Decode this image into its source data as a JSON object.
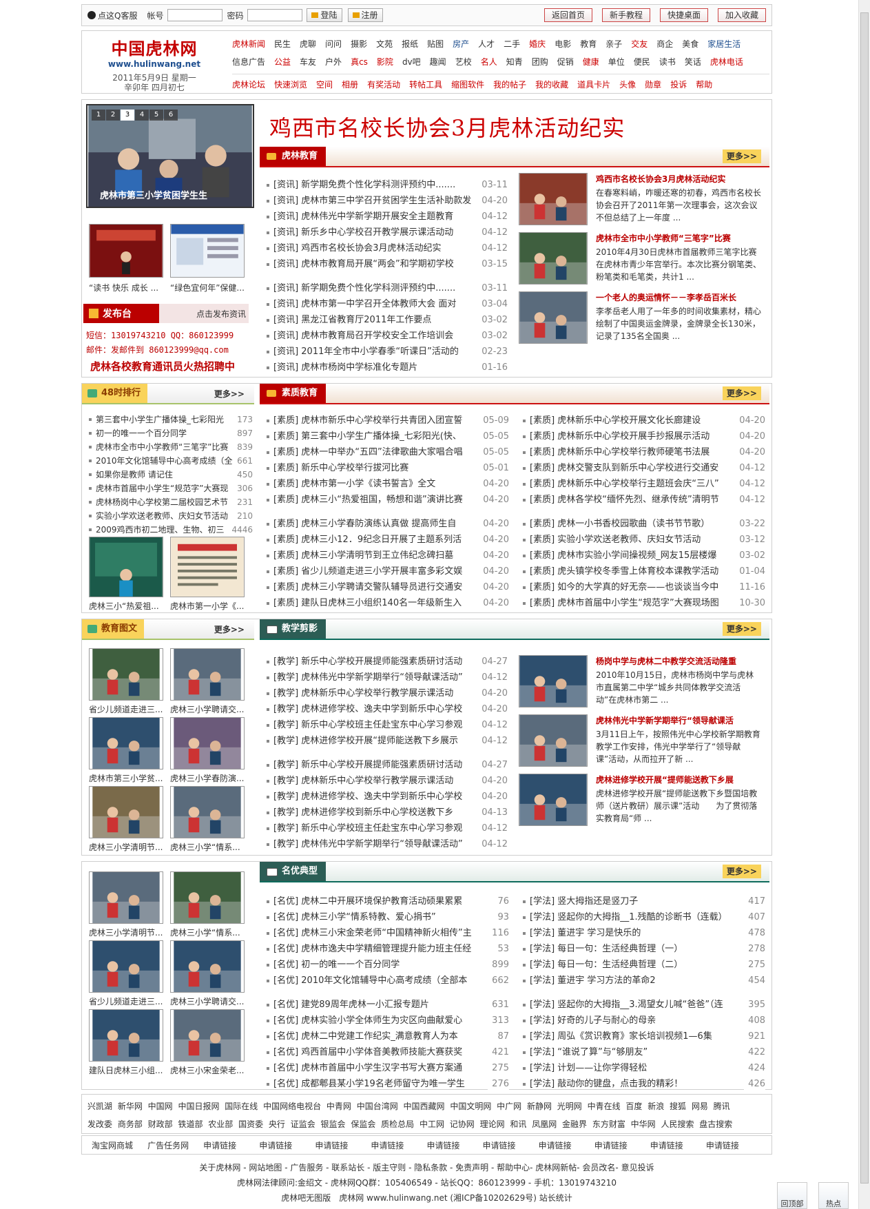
{
  "topbar": {
    "qq": "点这Q客服",
    "user_label": "帐号",
    "pass_label": "密码",
    "login": "登陆",
    "register": "注册",
    "home": "返回首页",
    "tutorial": "新手教程",
    "desktop": "快捷桌面",
    "favorite": "加入收藏"
  },
  "header": {
    "logo": "中国虎林网",
    "url": "www.hulinwang.net",
    "date": "2011年5月9日 星期一",
    "lunar": "辛卯年 四月初七",
    "nav1": [
      "虎林新闻",
      "民生",
      "虎聊",
      "问问",
      "摄影",
      "文苑",
      "报纸",
      "贴图",
      "房产",
      "人才",
      "二手",
      "婚庆",
      "电影",
      "教育",
      "亲子",
      "交友",
      "商企",
      "美食",
      "家居生活"
    ],
    "nav2": [
      "信息广告",
      "公益",
      "车友",
      "户外",
      "真cs",
      "影院",
      "dv吧",
      "趣闻",
      "艺校",
      "名人",
      "知青",
      "团购",
      "促销",
      "健康",
      "单位",
      "便民",
      "读书",
      "笑话",
      "虎林电话"
    ],
    "nav3": [
      "虎林论坛",
      "快速浏览",
      "空间",
      "相册",
      "有奖活动",
      "转帖工具",
      "缩图软件",
      "我的帖子",
      "我的收藏",
      "道具卡片",
      "头像",
      "勋章",
      "投诉",
      "帮助"
    ]
  },
  "colors": {
    "brand": "#c00000",
    "accent_teal": "#2c5d55",
    "gold": "#f9d35b"
  },
  "slider": {
    "tabs": [
      "1",
      "2",
      "3",
      "4",
      "5",
      "6"
    ],
    "caption": "虎林市第三小学贫困学生生"
  },
  "headline": "鸡西市名校长协会3月虎林活动纪实",
  "edu": {
    "title": "虎林教育",
    "more": "更多>>",
    "items": [
      [
        "[资讯] 新学期免费个性化学科测评预约中.......",
        "03-11"
      ],
      [
        "[资讯] 虎林市第三中学召开贫困学生生活补助款发",
        "04-20"
      ],
      [
        "[资讯] 虎林伟光中学新学期开展安全主题教育",
        "04-12"
      ],
      [
        "[资讯] 新乐乡中心学校召开教学展示课活动动",
        "04-12"
      ],
      [
        "[资讯] 鸡西市名校长协会3月虎林活动纪实",
        "04-12"
      ],
      [
        "[资讯] 虎林市教育局开展“两会”和学期初学校",
        "03-15"
      ]
    ],
    "items2": [
      [
        "[资讯] 新学期免费个性化学科测评预约中.......",
        "03-11"
      ],
      [
        "[资讯] 虎林市第一中学召开全体教师大会 面对",
        "03-04"
      ],
      [
        "[资讯] 黑龙江省教育厅2011年工作要点",
        "03-02"
      ],
      [
        "[资讯] 虎林市教育局召开学校安全工作培训会",
        "03-02"
      ],
      [
        "[资讯] 2011年全市中小学春季“听课日”活动的",
        "02-23"
      ],
      [
        "[资讯] 虎林市杨岗中学标准化专题片",
        "01-16"
      ]
    ],
    "news": [
      {
        "title": "鸡西市名校长协会3月虎林活动纪实",
        "text": "在春寒料峭，咋暖还寒的初春，鸡西市名校长协会召开了2011年第一次理事会，这次会议不但总结了上一年度 ..."
      },
      {
        "title": "虎林市全市中小学教师“三笔字”比赛",
        "text": "2010年4月30日虎林市首届教师三笔字比赛在虎林市青少年宫举行。本次比赛分钢笔类、粉笔类和毛笔类，共计1 ..."
      },
      {
        "title": "一个老人的奥运情怀－－李孝岳百米长",
        "text": "李孝岳老人用了一年多的时间收集素材，精心绘制了中国奥运金牌录，金牌录全长130米，记录了135名全国奥 ..."
      }
    ]
  },
  "small_pics": [
    "“读书 快乐 成长 ...",
    "“绿色宜何年”保健..."
  ],
  "publish": {
    "title": "发布台",
    "action": "点击发布资讯",
    "sms": "短信：13019743210  QQ：860123999",
    "email": "邮件：发邮件到 860123999@qq.com",
    "recruit": "虎林各校教育通讯员火热招聘中"
  },
  "rank": {
    "title": "48时排行",
    "more": "更多>>",
    "items": [
      [
        "第三套中小学生广播体操_七彩阳光",
        "173"
      ],
      [
        "初一的唯一一个百分同学",
        "897"
      ],
      [
        "虎林市全市中小学教师“三笔字”比赛",
        "839"
      ],
      [
        "2010年文化馆辅导中心高考成绩（全",
        "661"
      ],
      [
        "如果你是教师 请记住",
        "450"
      ],
      [
        "虎林市首届中小学生“规范字”大赛现",
        "306"
      ],
      [
        "虎林杨岗中心学校第二届校园艺术节",
        "231"
      ],
      [
        "实验小学欢送老教师、庆妇女节活动",
        "210"
      ],
      [
        "2009鸡西市初二地理、生物、初三",
        "4446"
      ]
    ],
    "pics": [
      "虎林三小“热爱祖...",
      "虎林市第一小学《..."
    ]
  },
  "quality": {
    "title": "素质教育",
    "more": "更多>>",
    "left": [
      [
        "[素质] 虎林市新乐中心学校举行共青团入团宣誓",
        "05-09"
      ],
      [
        "[素质] 第三套中小学生广播体操_七彩阳光(快、",
        "05-05"
      ],
      [
        "[素质] 虎林一中举办“五四”法律歌曲大家唱合唱",
        "05-05"
      ],
      [
        "[素质] 新乐中心学校举行拔河比赛",
        "05-01"
      ],
      [
        "[素质] 虎林市第一小学《读书誓言》全文",
        "04-20"
      ],
      [
        "[素质] 虎林三小“热爱祖国，畅想和谐”演讲比赛",
        "04-20"
      ]
    ],
    "left2": [
      [
        "[素质] 虎林三小学春防演练认真做 提高师生自",
        "04-20"
      ],
      [
        "[素质] 虎林三小12．9纪念日开展了主题系列活",
        "04-20"
      ],
      [
        "[素质] 虎林三小学清明节到王立伟纪念碑扫墓",
        "04-20"
      ],
      [
        "[素质] 省少儿频道走进三小学开展丰富多彩文娱",
        "04-20"
      ],
      [
        "[素质] 虎林三小学聘请交警队辅导员进行交通安",
        "04-20"
      ],
      [
        "[素质] 建队日虎林三小组织140名一年级新生入",
        "04-20"
      ]
    ],
    "right": [
      [
        "[素质] 虎林新乐中心学校开展文化长廊建设",
        "04-20"
      ],
      [
        "[素质] 虎林新乐中心学校开展手抄报展示活动",
        "04-20"
      ],
      [
        "[素质] 虎林新乐中心学校举行教师硬笔书法展",
        "04-20"
      ],
      [
        "[素质] 虎林交警支队到新乐中心学校进行交通安",
        "04-12"
      ],
      [
        "[素质] 虎林新乐中心学校举行主题班会庆“三八”",
        "04-12"
      ],
      [
        "[素质] 虎林各学校“缅怀先烈、继承传统”清明节",
        "04-12"
      ]
    ],
    "right2": [
      [
        "[素质] 虎林一小书香校园歌曲（读书节节歌）",
        "03-22"
      ],
      [
        "[素质] 实验小学欢送老教师、庆妇女节活动",
        "03-12"
      ],
      [
        "[素质] 虎林市实验小学间操视频_网友15层楼爆",
        "03-02"
      ],
      [
        "[素质] 虎头镇学校冬季雪上体育校本课教学活动",
        "01-04"
      ],
      [
        "[素质] 如今的大学真的好无奈——也谈谈当今中",
        "11-16"
      ],
      [
        "[素质] 虎林市首届中小学生“规范字”大赛现场图",
        "10-30"
      ]
    ]
  },
  "pictext": {
    "title": "教育图文",
    "more": "更多>>",
    "caps": [
      "省少儿频道走进三...",
      "虎林三小学聘请交...",
      "虎林市第三小学贫...",
      "虎林三小学春防演...",
      "虎林三小学清明节...",
      "虎林三小学“情系..."
    ]
  },
  "teaching": {
    "title": "教学剪影",
    "more": "更多>>",
    "items": [
      [
        "[教学] 新乐中心学校开展提师能强素质研讨活动",
        "04-27"
      ],
      [
        "[教学] 虎林伟光中学新学期举行“领导献课活动”",
        "04-12"
      ],
      [
        "[教学] 虎林新乐中心学校举行教学展示课活动",
        "04-20"
      ],
      [
        "[教学] 虎林进修学校、逸夫中学到新乐中心学校",
        "04-20"
      ],
      [
        "[教学] 新乐中心学校班主任赴宝东中心学习参观",
        "04-12"
      ],
      [
        "[教学] 虎林进修学校开展“提师能送教下乡展示",
        "04-12"
      ]
    ],
    "items2": [
      [
        "[教学] 新乐中心学校开展提师能强素质研讨活动",
        "04-27"
      ],
      [
        "[教学] 虎林新乐中心学校举行教学展示课活动",
        "04-20"
      ],
      [
        "[教学] 虎林进修学校、逸夫中学到新乐中心学校",
        "04-20"
      ],
      [
        "[教学] 虎林进修学校到新乐中心学校送教下乡",
        "04-13"
      ],
      [
        "[教学] 新乐中心学校班主任赴宝东中心学习参观",
        "04-12"
      ],
      [
        "[教学] 虎林伟光中学新学期举行“领导献课活动”",
        "04-12"
      ]
    ],
    "news": [
      {
        "title": "杨岗中学与虎林二中教学交流活动隆重",
        "text": "2010年10月15日，虎林市杨岗中学与虎林市直属第二中学“城乡共同体教学交流活动”在虎林市第二 ..."
      },
      {
        "title": "虎林伟光中学新学期举行“领导献课活",
        "text": "3月11日上午，按照伟光中心学校新学期教育教学工作安排，伟光中学举行了“领导献课”活动，从而拉开了新 ..."
      },
      {
        "title": "虎林进修学校开展“提师能送教下乡展",
        "text": "虎林进修学校开展“提师能送教下乡暨国培教师（送片教研）展示课”活动　　为了贯彻落实教育局“师 ..."
      }
    ]
  },
  "famous": {
    "title": "名优典型",
    "more": "更多>>",
    "caps": [
      "虎林三小学清明节...",
      "虎林三小学“情系...",
      "省少儿频道走进三...",
      "虎林三小学聘请交...",
      "建队日虎林三小组...",
      "虎林三小宋金荣老..."
    ],
    "left": [
      [
        "[名优] 虎林二中开展环境保护教育活动硕果累累",
        "76"
      ],
      [
        "[名优] 虎林三小学“情系特教、爱心捐书”",
        "93"
      ],
      [
        "[名优] 虎林三小宋金荣老师“中国精神新火相传”主",
        "116"
      ],
      [
        "[名优] 虎林市逸夫中学精细管理提升能力班主任经",
        "53"
      ],
      [
        "[名优] 初一的唯一一个百分同学",
        "899"
      ],
      [
        "[名优] 2010年文化馆辅导中心高考成绩（全部本",
        "662"
      ]
    ],
    "left2": [
      [
        "[名优] 建党89周年虎林一小汇报专题片",
        "631"
      ],
      [
        "[名优] 虎林实验小学全体师生为灾区向曲献爱心",
        "313"
      ],
      [
        "[名优] 虎林二中党建工作纪实_满意教育人为本",
        "87"
      ],
      [
        "[名优] 鸡西首届中小学体音美教师技能大赛获奖",
        "421"
      ],
      [
        "[名优] 虎林市首届中小学生汉字书写大赛方案通",
        "275"
      ],
      [
        "[名优] 成都郫县某小学19名老师留守为唯一学生",
        "276"
      ]
    ],
    "right": [
      [
        "[学法] 竖大拇指还是竖刀子",
        "417"
      ],
      [
        "[学法] 竖起你的大拇指__1.残酷的诊断书（连载）",
        "407"
      ],
      [
        "[学法] 董进宇 学习是快乐的",
        "478"
      ],
      [
        "[学法] 每日一句：生活经典哲理（一）",
        "278"
      ],
      [
        "[学法] 每日一句：生活经典哲理（二）",
        "275"
      ],
      [
        "[学法] 董进宇 学习方法的革命2",
        "454"
      ]
    ],
    "right2": [
      [
        "[学法] 竖起你的大拇指__3.渴望女儿喊“爸爸”（连",
        "395"
      ],
      [
        "[学法] 好奇的儿子与耐心的母亲",
        "408"
      ],
      [
        "[学法] 周弘《赏识教育》家长培训视频1—6集",
        "921"
      ],
      [
        "[学法] “谁说了算”与“够朋友”",
        "422"
      ],
      [
        "[学法] 计划——让你学得轻松",
        "424"
      ],
      [
        "[学法] 敲动你的键盘，点击我的精彩！",
        "426"
      ]
    ]
  },
  "links": {
    "row1": "兴凯湖 新华网 中国网 中国日报网 国际在线 中国网络电视台 中青网 中国台湾网 中国西藏网 中国文明网 中广网 新静网 光明网 中青在线 百度 新浪 搜狐 网易 腾讯",
    "row2": "发改委 商务部 财政部 铁道部 农业部 国资委 央行 证监会 银监会 保监会 质检总局 中工网 记协网 理论网 和讯 凤凰网 金融界 东方财富 中华网 人民搜索 盘古搜索",
    "row3": [
      "淘宝网商城",
      "广告任务网",
      "申请链接",
      "申请链接",
      "申请链接",
      "申请链接",
      "申请链接",
      "申请链接",
      "申请链接",
      "申请链接",
      "申请链接",
      "申请链接"
    ]
  },
  "footer": {
    "l1": "关于虎林网 - 网站地图 - 广告服务 - 联系站长 - 版主守则 - 隐私条款 - 免责声明 - 帮助中心- 虎林网新帖- 会员改名- 意见投诉",
    "l2": "虎林网法律顾问:金绍文 - 虎林网QQ群：105406549 - 站长QQ：860123999 - 手机：13019743210",
    "l3": "虎林吧无图版　虎林网 www.hulinwang.net (湘ICP备10202629号) 站长统计"
  },
  "side": {
    "top": "回顶部",
    "hot": "热点"
  }
}
